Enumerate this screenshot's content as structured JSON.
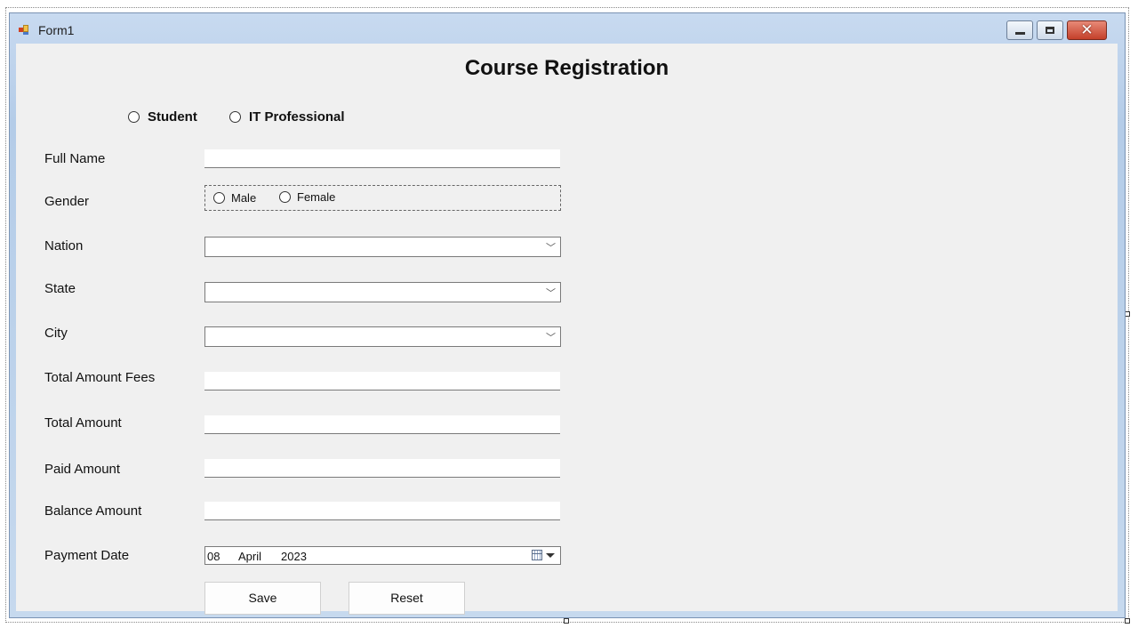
{
  "window": {
    "title": "Form1",
    "close_glyph": "✕"
  },
  "form": {
    "heading": "Course Registration",
    "type_options": [
      "Student",
      "IT Professional"
    ],
    "gender_options": [
      "Male",
      "Female"
    ],
    "labels": {
      "full_name": "Full Name",
      "gender": "Gender",
      "nation": "Nation",
      "state": "State",
      "city": "City",
      "total_amount_fees": "Total Amount Fees",
      "total_amount": "Total Amount",
      "paid_amount": "Paid Amount",
      "balance_amount": "Balance Amount",
      "payment_date": "Payment Date"
    },
    "values": {
      "full_name": "",
      "nation": "",
      "state": "",
      "city": "",
      "total_amount_fees": "",
      "total_amount": "",
      "paid_amount": "",
      "balance_amount": ""
    },
    "payment_date": {
      "day": "08",
      "month": "April",
      "year": "2023"
    },
    "buttons": {
      "save": "Save",
      "reset": "Reset"
    },
    "dropdown_glyph": "﹀"
  },
  "icons": {
    "app": "form-app-icon",
    "minimize": "minimize-icon",
    "maximize": "maximize-icon",
    "close": "close-icon",
    "calendar": "calendar-icon",
    "dropdown": "chevron-down-icon"
  },
  "colors": {
    "title_gradient": "#b4cce8",
    "client_bg": "#f0f0f0",
    "close_button": "#c4402a"
  }
}
